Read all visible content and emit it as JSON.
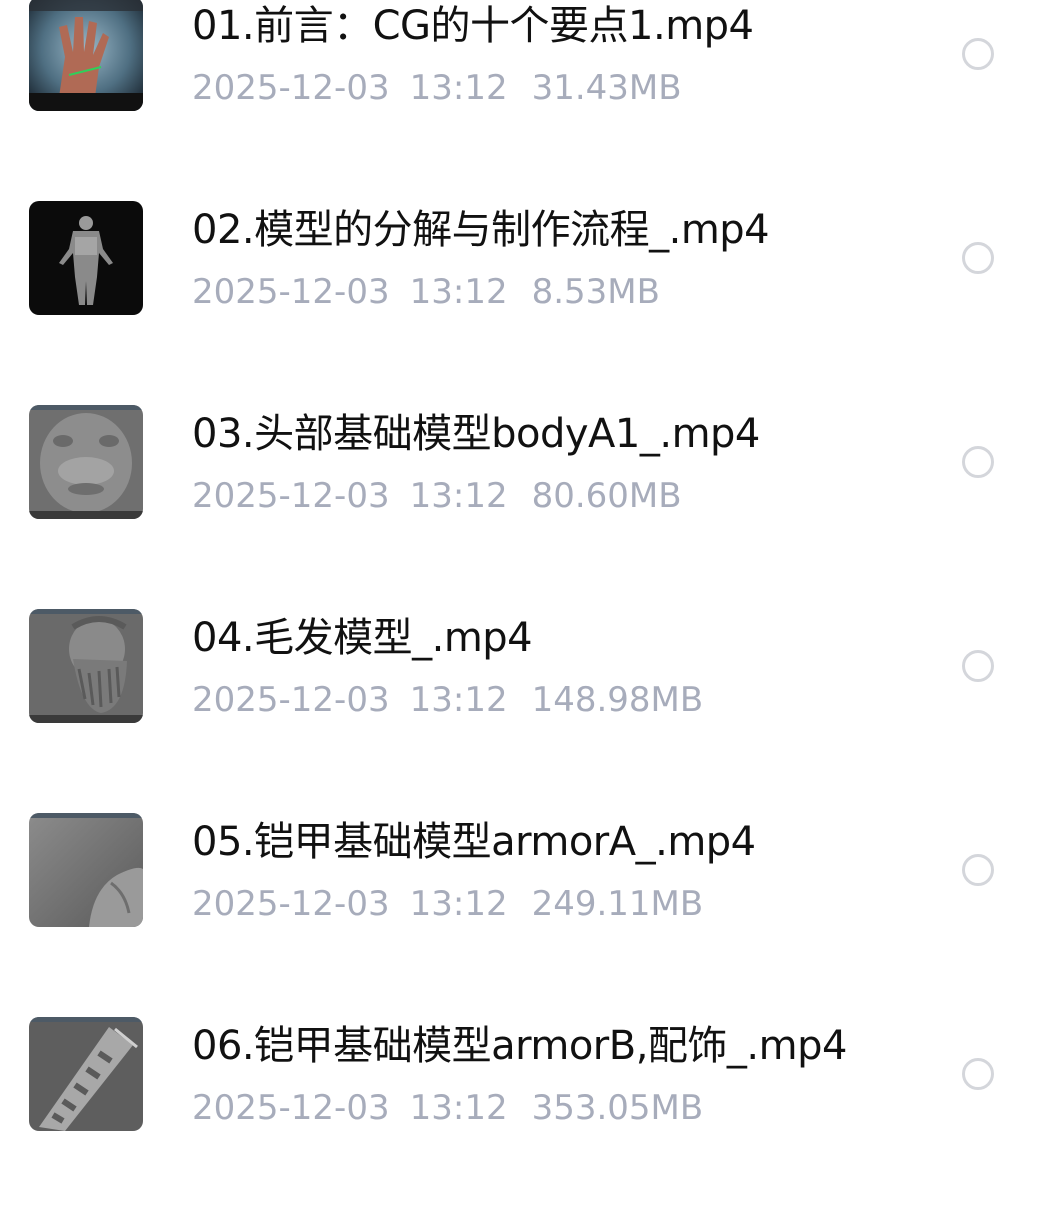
{
  "files": [
    {
      "name": "01.前言：CG的十个要点1.mp4",
      "date": "2025-12-03",
      "time": "13:12",
      "size": "31.43MB",
      "thumbnail": "hand-image-icon"
    },
    {
      "name": "02.模型的分解与制作流程_.mp4",
      "date": "2025-12-03",
      "time": "13:12",
      "size": "8.53MB",
      "thumbnail": "armored-figure-icon"
    },
    {
      "name": "03.头部基础模型bodyA1_.mp4",
      "date": "2025-12-03",
      "time": "13:12",
      "size": "80.60MB",
      "thumbnail": "head-model-icon"
    },
    {
      "name": "04.毛发模型_.mp4",
      "date": "2025-12-03",
      "time": "13:12",
      "size": "148.98MB",
      "thumbnail": "bearded-head-icon"
    },
    {
      "name": "05.铠甲基础模型armorA_.mp4",
      "date": "2025-12-03",
      "time": "13:12",
      "size": "249.11MB",
      "thumbnail": "torso-model-icon"
    },
    {
      "name": "06.铠甲基础模型armorB,配饰_.mp4",
      "date": "2025-12-03",
      "time": "13:12",
      "size": "353.05MB",
      "thumbnail": "armor-piece-icon"
    }
  ],
  "colors": {
    "title": "#111111",
    "meta": "#a7acbb",
    "radio_border": "#d4d6db",
    "background": "#ffffff"
  }
}
